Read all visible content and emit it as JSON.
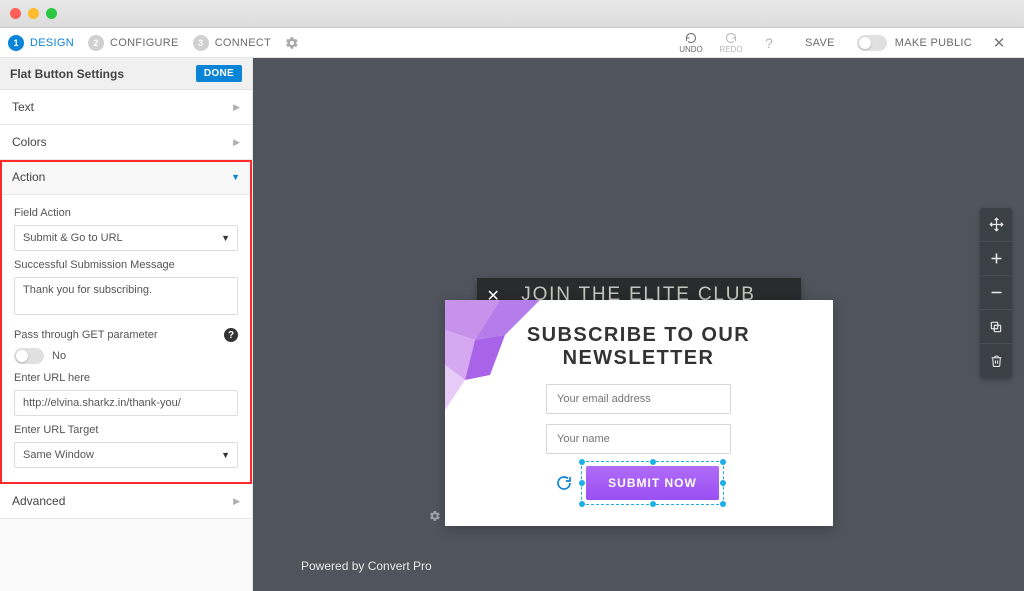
{
  "steps": [
    {
      "num": "1",
      "label": "DESIGN",
      "active": true
    },
    {
      "num": "2",
      "label": "CONFIGURE",
      "active": false
    },
    {
      "num": "3",
      "label": "CONNECT",
      "active": false
    }
  ],
  "topbar": {
    "undo": "UNDO",
    "redo": "REDO",
    "save": "SAVE",
    "make_public": "MAKE PUBLIC"
  },
  "panel": {
    "title": "Flat Button Settings",
    "done": "DONE",
    "sections": {
      "text": "Text",
      "colors": "Colors",
      "action": "Action",
      "advanced": "Advanced"
    },
    "action": {
      "field_action_label": "Field Action",
      "field_action_value": "Submit & Go to URL",
      "success_msg_label": "Successful Submission Message",
      "success_msg_value": "Thank you for subscribing.",
      "get_param_label": "Pass through GET parameter",
      "get_param_state": "No",
      "url_label": "Enter URL here",
      "url_value": "http://elvina.sharkz.in/thank-you/",
      "target_label": "Enter URL Target",
      "target_value": "Same Window"
    }
  },
  "popup": {
    "banner_title": "JOIN THE ELITE CLUB",
    "card_title_line1": "SUBSCRIBE TO OUR",
    "card_title_line2": "NEWSLETTER",
    "email_placeholder": "Your email address",
    "name_placeholder": "Your name",
    "submit_label": "SUBMIT NOW"
  },
  "footer": "Powered by Convert Pro"
}
